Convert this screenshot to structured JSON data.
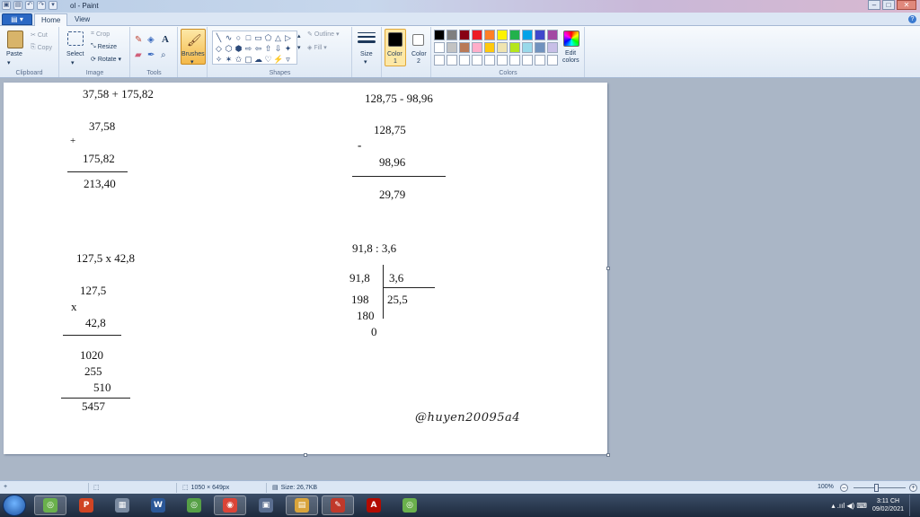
{
  "window": {
    "title": "ol - Paint",
    "controls": {
      "minimize": "–",
      "maximize": "□",
      "close": "✕"
    }
  },
  "tabs": {
    "file": "▾",
    "items": [
      "Home",
      "View"
    ]
  },
  "ribbon": {
    "clipboard": {
      "label": "Clipboard",
      "paste": "Paste",
      "cut": "Cut",
      "copy": "Copy"
    },
    "image": {
      "label": "Image",
      "select": "Select",
      "crop": "Crop",
      "resize": "Resize",
      "rotate": "Rotate ▾"
    },
    "tools": {
      "label": "Tools",
      "text_tool": "A"
    },
    "brushes": {
      "label": "Brushes"
    },
    "shapes": {
      "label": "Shapes",
      "outline": "Outline ▾",
      "fill": "Fill ▾",
      "glyphs": [
        "╲",
        "∿",
        "○",
        "□",
        "▭",
        "⬠",
        "△",
        "▷",
        "◇",
        "⬡",
        "⬢",
        "⇨",
        "⇦",
        "⇧",
        "⇩",
        "✦",
        "✧",
        "✶",
        "✩",
        "▢",
        "☁",
        "♡",
        "⚡",
        "▿"
      ]
    },
    "size": {
      "label": "Size"
    },
    "color1": {
      "label": "Color",
      "num": "1",
      "value": "#000000"
    },
    "color2": {
      "label": "Color",
      "num": "2",
      "value": "#ffffff"
    },
    "colors": {
      "label": "Colors",
      "edit_label": "Edit",
      "edit_label2": "colors",
      "palette": [
        "#000000",
        "#7f7f7f",
        "#880015",
        "#ed1c24",
        "#ff7f27",
        "#fff200",
        "#22b14c",
        "#00a2e8",
        "#3f48cc",
        "#a349a4",
        "#ffffff",
        "#c3c3c3",
        "#b97a57",
        "#ffaec9",
        "#ffc90e",
        "#efe4b0",
        "#b5e61d",
        "#99d9ea",
        "#7092be",
        "#c8bfe7",
        "#ffffff",
        "#ffffff",
        "#ffffff",
        "#ffffff",
        "#ffffff",
        "#ffffff",
        "#ffffff",
        "#ffffff",
        "#ffffff",
        "#ffffff"
      ]
    }
  },
  "canvas_text": {
    "add_title": "37,58 + 175,82",
    "add_a": "37,58",
    "add_op": "+",
    "add_b": "175,82",
    "add_result": "213,40",
    "sub_title": "128,75 - 98,96",
    "sub_a": "128,75",
    "sub_op": "-",
    "sub_b": "98,96",
    "sub_result": "29,79",
    "mul_title": "127,5 x 42,8",
    "mul_a": "127,5",
    "mul_op": "x",
    "mul_b": "42,8",
    "mul_p1": "1020",
    "mul_p2": "255",
    "mul_p3": "510",
    "mul_result": "5457",
    "div_title": "91,8 : 3,6",
    "div_dividend": "91,8",
    "div_divisor": "3,6",
    "div_quotient": "25,5",
    "div_r1": "198",
    "div_r2": "180",
    "div_r3": "0",
    "watermark": "@huyen20095a4"
  },
  "status": {
    "add": "+",
    "canvas_size": "1050 × 649px",
    "file_size": "Size: 26,7KB",
    "zoom": "100%",
    "zoom_minus": "–",
    "zoom_plus": "+"
  },
  "taskbar": {
    "apps": [
      {
        "glyph": "◎",
        "color": "#6ab04c"
      },
      {
        "glyph": "P",
        "color": "#d04423"
      },
      {
        "glyph": "▦",
        "color": "#7a8aa0"
      },
      {
        "glyph": "W",
        "color": "#2b5797"
      },
      {
        "glyph": "◎",
        "color": "#56a046"
      },
      {
        "glyph": "◉",
        "color": "#db4437"
      },
      {
        "glyph": "▣",
        "color": "#5a6e90"
      },
      {
        "glyph": "▤",
        "color": "#d9a43b"
      },
      {
        "glyph": "✎",
        "color": "#c0392b"
      },
      {
        "glyph": "A",
        "color": "#b30b00"
      },
      {
        "glyph": "◎",
        "color": "#6ab04c"
      }
    ],
    "tray_icons": "▴  .ııl  ◀)  ⌨",
    "time": "3:11 CH",
    "date": "09/02/2021"
  }
}
